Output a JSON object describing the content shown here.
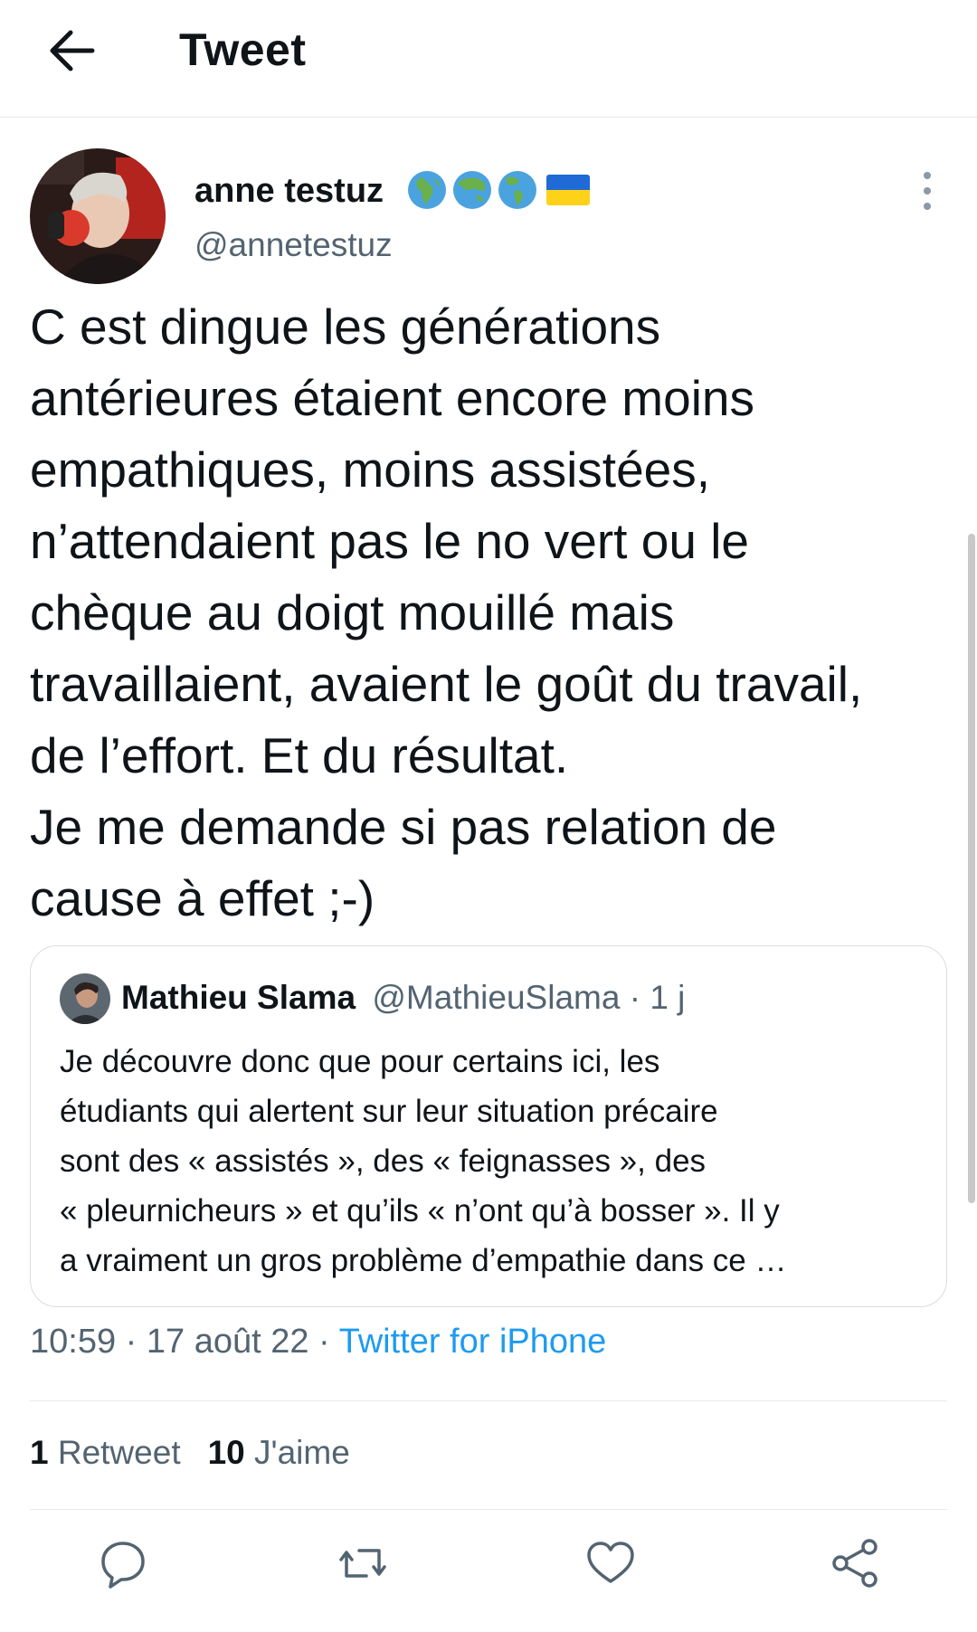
{
  "header": {
    "title": "Tweet",
    "back_icon": "arrow-left-icon"
  },
  "author": {
    "name": "anne testuz",
    "handle": "@annetestuz",
    "emojis": [
      "globe-africa-icon",
      "globe-asia-icon",
      "globe-americas-icon",
      "ukraine-flag-icon"
    ]
  },
  "tweet": {
    "text": "C est dingue les générations\nantérieures étaient encore moins\nempathiques, moins assistées,\nn’attendaient pas le no vert ou le\nchèque au doigt mouillé mais\ntravaillaient, avaient le goût du travail,\nde l’effort. Et du résultat.\nJe me demande si pas relation de\ncause à effet ;-)"
  },
  "quote": {
    "name": "Mathieu Slama",
    "handle": "@MathieuSlama",
    "separator": "·",
    "time": "1 j",
    "text": "Je découvre donc que pour certains ici, les\nétudiants qui alertent sur leur situation précaire\nsont des « assistés », des « feignasses », des\n« pleurnicheurs » et qu’ils « n’ont qu’à bosser ». Il y\na vraiment un gros problème d’empathie dans ce …"
  },
  "meta": {
    "time": "10:59",
    "sep1": " · ",
    "date": "17 août 22",
    "sep2": " · ",
    "source": "Twitter for iPhone"
  },
  "stats": {
    "retweets_count": "1",
    "retweets_label": "Retweet",
    "likes_count": "10",
    "likes_label": "J'aime"
  },
  "actions": [
    "reply-icon",
    "retweet-icon",
    "like-icon",
    "share-icon"
  ],
  "colors": {
    "accent": "#1d9bf0",
    "muted": "#536471",
    "text": "#0f1419",
    "border": "#e6e9eb"
  }
}
